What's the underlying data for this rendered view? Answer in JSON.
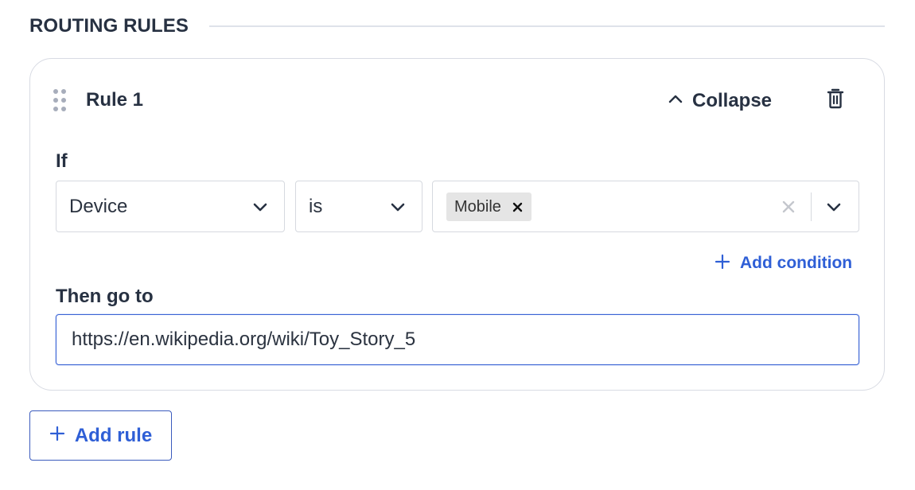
{
  "section": {
    "title": "ROUTING RULES"
  },
  "rule": {
    "title": "Rule 1",
    "collapse_label": "Collapse",
    "if_label": "If",
    "condition": {
      "field": "Device",
      "operator": "is",
      "values": [
        "Mobile"
      ]
    },
    "add_condition_label": "Add condition",
    "then_label": "Then go to",
    "destination_url": "https://en.wikipedia.org/wiki/Toy_Story_5"
  },
  "add_rule_label": "Add rule",
  "icons": {
    "drag": "drag-handle-icon",
    "collapse": "chevron-up-icon",
    "delete": "trash-icon",
    "dropdown": "chevron-down-icon",
    "remove": "close-icon",
    "add": "plus-icon"
  },
  "colors": {
    "heading": "#273142",
    "accent": "#2f5fd6",
    "border": "#d6d9df",
    "chip_bg": "#e5e5e5"
  }
}
